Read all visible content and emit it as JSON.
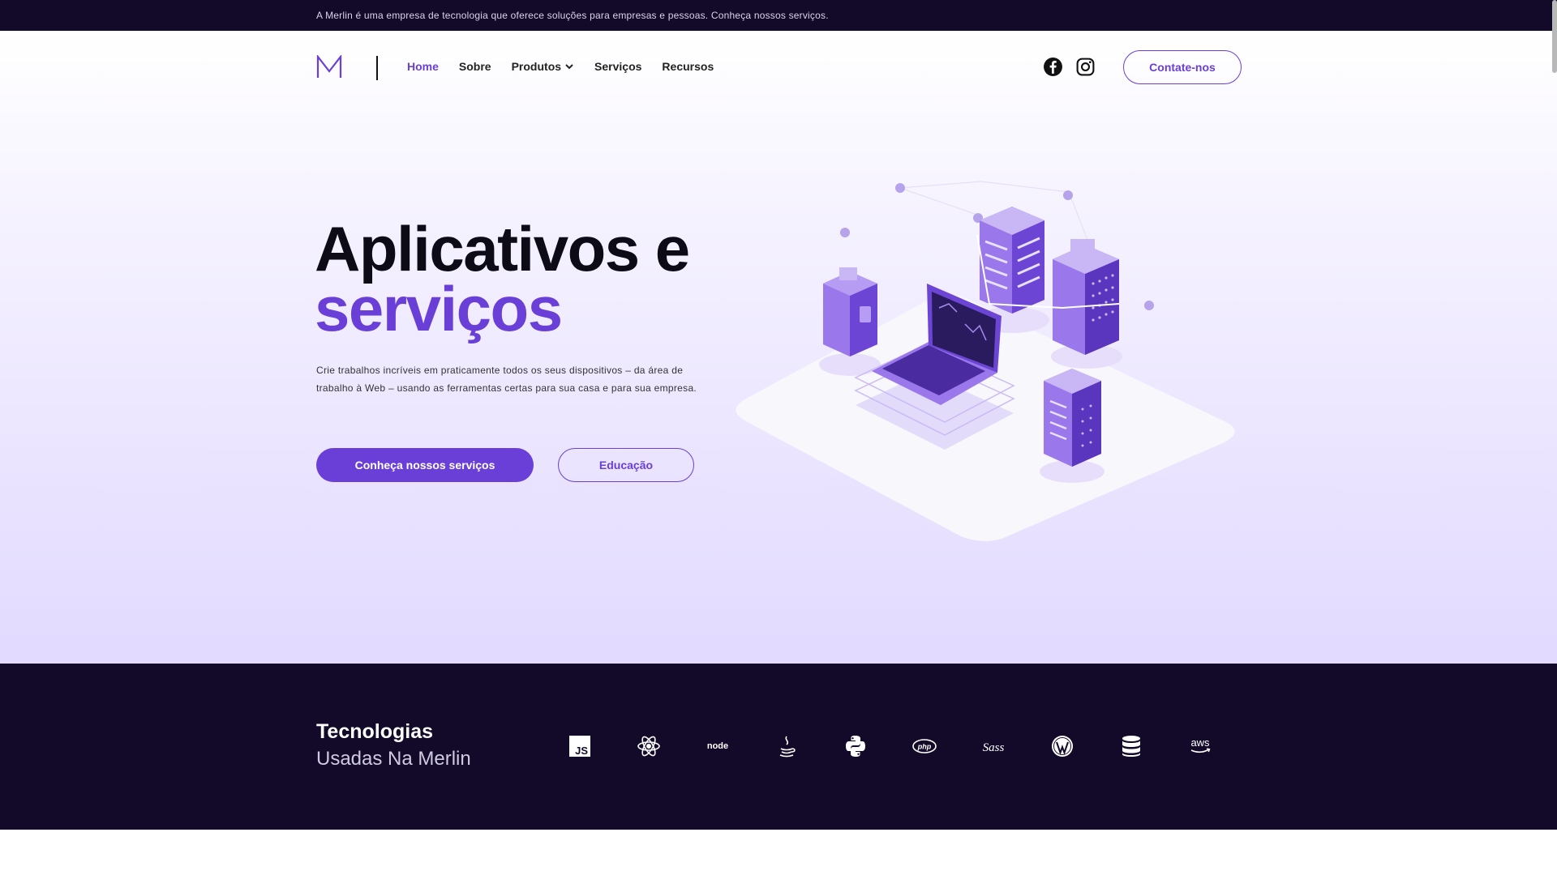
{
  "announcement": "A Merlin é uma empresa de tecnologia que oferece soluções para empresas e pessoas. Conheça nossos serviços.",
  "nav": {
    "logo_icon": "merlin-m-logo",
    "items": [
      {
        "label": "Home",
        "active": true
      },
      {
        "label": "Sobre",
        "active": false
      },
      {
        "label": "Produtos",
        "active": false,
        "dropdown": true
      },
      {
        "label": "Serviços",
        "active": false
      },
      {
        "label": "Recursos",
        "active": false
      }
    ],
    "social_icons": [
      "facebook-icon",
      "instagram-icon"
    ],
    "contact_label": "Contate-nos"
  },
  "hero": {
    "title_line1": "Aplicativos e",
    "title_line2": "serviços",
    "description": "Crie trabalhos incríveis em praticamente todos os seus dispositivos – da área de trabalho à Web – usando as ferramentas certas para sua casa e para sua empresa.",
    "primary_button": "Conheça nossos serviços",
    "secondary_button": "Educação",
    "illustration": "isometric-servers-laptop-illustration"
  },
  "technologies": {
    "title": "Tecnologias",
    "subtitle": "Usadas Na Merlin",
    "icons": [
      "javascript-icon",
      "react-icon",
      "node-icon",
      "java-icon",
      "python-icon",
      "php-icon",
      "sass-icon",
      "wordpress-icon",
      "database-icon",
      "aws-icon"
    ]
  },
  "colors": {
    "accent": "#6a3fd8",
    "dark": "#130a2a",
    "text": "#0d0b16"
  }
}
